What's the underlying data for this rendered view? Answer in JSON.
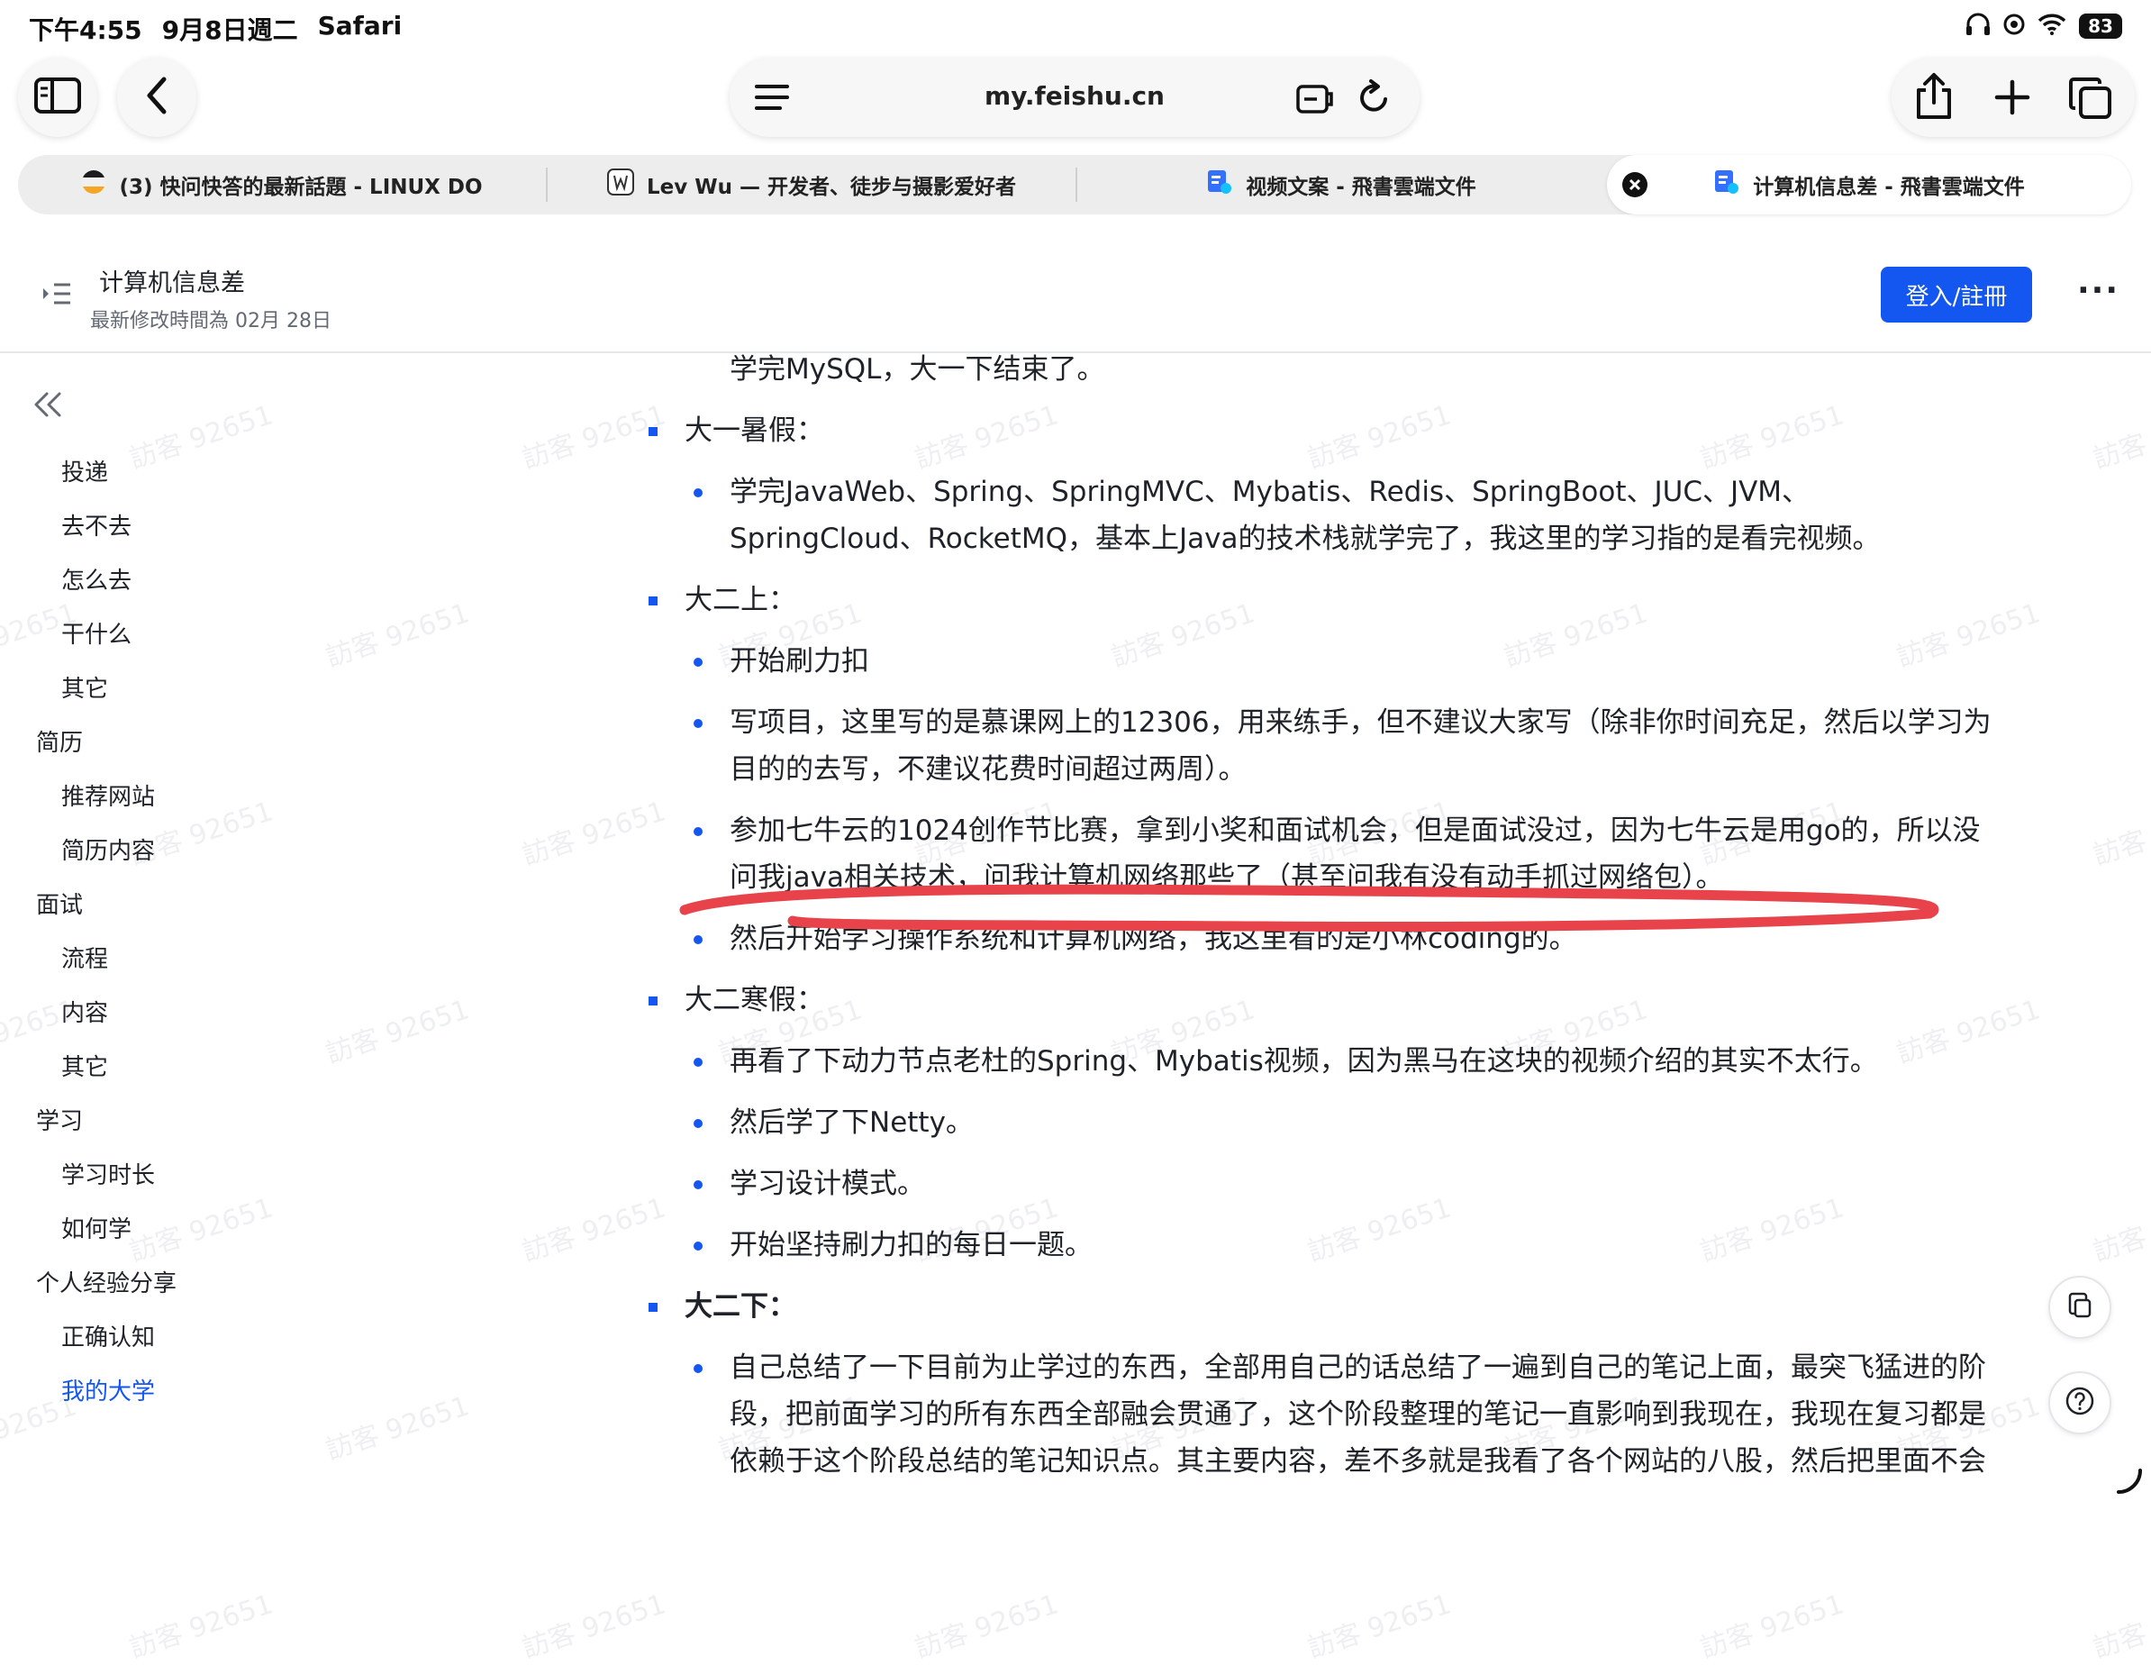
{
  "status_bar": {
    "time": "下午4:55",
    "date": "9月8日週二",
    "app": "Safari",
    "battery": "83"
  },
  "browser": {
    "url": "my.feishu.cn",
    "tabs": [
      {
        "title": "(3) 快问快答的最新話題 - LINUX DO",
        "icon": "linuxdo-icon"
      },
      {
        "title": "Lev Wu — 开发者、徒步与摄影爱好者",
        "icon": "lev-wu-icon"
      },
      {
        "title": "视频文案 - 飛書雲端文件",
        "icon": "feishu-doc-icon"
      },
      {
        "title": "计算机信息差 - 飛書雲端文件",
        "icon": "feishu-doc-icon",
        "active": true
      }
    ]
  },
  "doc": {
    "title": "计算机信息差",
    "modified": "最新修改時間為 02月 28日",
    "login_label": "登入/註冊",
    "more_label": "···"
  },
  "toc": {
    "items": [
      {
        "label": "投递",
        "level": 2
      },
      {
        "label": "去不去",
        "level": 2
      },
      {
        "label": "怎么去",
        "level": 2
      },
      {
        "label": "干什么",
        "level": 2
      },
      {
        "label": "其它",
        "level": 2
      },
      {
        "label": "简历",
        "level": 1
      },
      {
        "label": "推荐网站",
        "level": 2
      },
      {
        "label": "简历内容",
        "level": 2
      },
      {
        "label": "面试",
        "level": 1
      },
      {
        "label": "流程",
        "level": 2
      },
      {
        "label": "内容",
        "level": 2
      },
      {
        "label": "其它",
        "level": 2
      },
      {
        "label": "学习",
        "level": 1
      },
      {
        "label": "学习时长",
        "level": 2
      },
      {
        "label": "如何学",
        "level": 2
      },
      {
        "label": "个人经验分享",
        "level": 1
      },
      {
        "label": "正确认知",
        "level": 2
      },
      {
        "label": "我的大学",
        "level": 2,
        "active": true
      }
    ]
  },
  "content": {
    "lines": [
      {
        "text": "学完MySQL，大一下结束了。",
        "bullet": "none"
      },
      {
        "text": "大一暑假：",
        "bullet": "square"
      },
      {
        "text": "学完JavaWeb、Spring、SpringMVC、Mybatis、Redis、SpringBoot、JUC、JVM、",
        "bullet": "round"
      },
      {
        "text": "SpringCloud、RocketMQ，基本上Java的技术栈就学完了，我这里的学习指的是看完视频。",
        "bullet": "none"
      },
      {
        "text": "大二上：",
        "bullet": "square"
      },
      {
        "text": "开始刷力扣",
        "bullet": "round"
      },
      {
        "text": "写项目，这里写的是慕课网上的12306，用来练手，但不建议大家写（除非你时间充足，然后以学习为",
        "bullet": "round"
      },
      {
        "text": "目的的去写，不建议花费时间超过两周）。",
        "bullet": "none"
      },
      {
        "text": "参加七牛云的1024创作节比赛，拿到小奖和面试机会，但是面试没过，因为七牛云是用go的，所以没",
        "bullet": "round"
      },
      {
        "text": "问我java相关技术，问我计算机网络那些了（甚至问我有没有动手抓过网络包）。",
        "bullet": "none"
      },
      {
        "text": "然后开始学习操作系统和计算机网络，我这里看的是小林coding的。",
        "bullet": "round"
      },
      {
        "text": "大二寒假：",
        "bullet": "square"
      },
      {
        "text": "再看了下动力节点老杜的Spring、Mybatis视频，因为黑马在这块的视频介绍的其实不太行。",
        "bullet": "round"
      },
      {
        "text": "然后学了下Netty。",
        "bullet": "round"
      },
      {
        "text": "学习设计模式。",
        "bullet": "round"
      },
      {
        "text": "开始坚持刷力扣的每日一题。",
        "bullet": "round"
      },
      {
        "text": "大二下：",
        "bullet": "square",
        "bold": true
      },
      {
        "text": "自己总结了一下目前为止学过的东西，全部用自己的话总结了一遍到自己的笔记上面，最突飞猛进的阶",
        "bullet": "round"
      },
      {
        "text": "段，把前面学习的所有东西全部融会贯通了，这个阶段整理的笔记一直影响到我现在，我现在复习都是",
        "bullet": "none"
      },
      {
        "text": "依赖于这个阶段总结的笔记知识点。其主要内容，差不多就是我看了各个网站的八股，然后把里面不会",
        "bullet": "none"
      }
    ]
  },
  "watermark": "訪客 92651",
  "colors": {
    "accent": "#1456f0",
    "annotation": "#e8424b"
  }
}
